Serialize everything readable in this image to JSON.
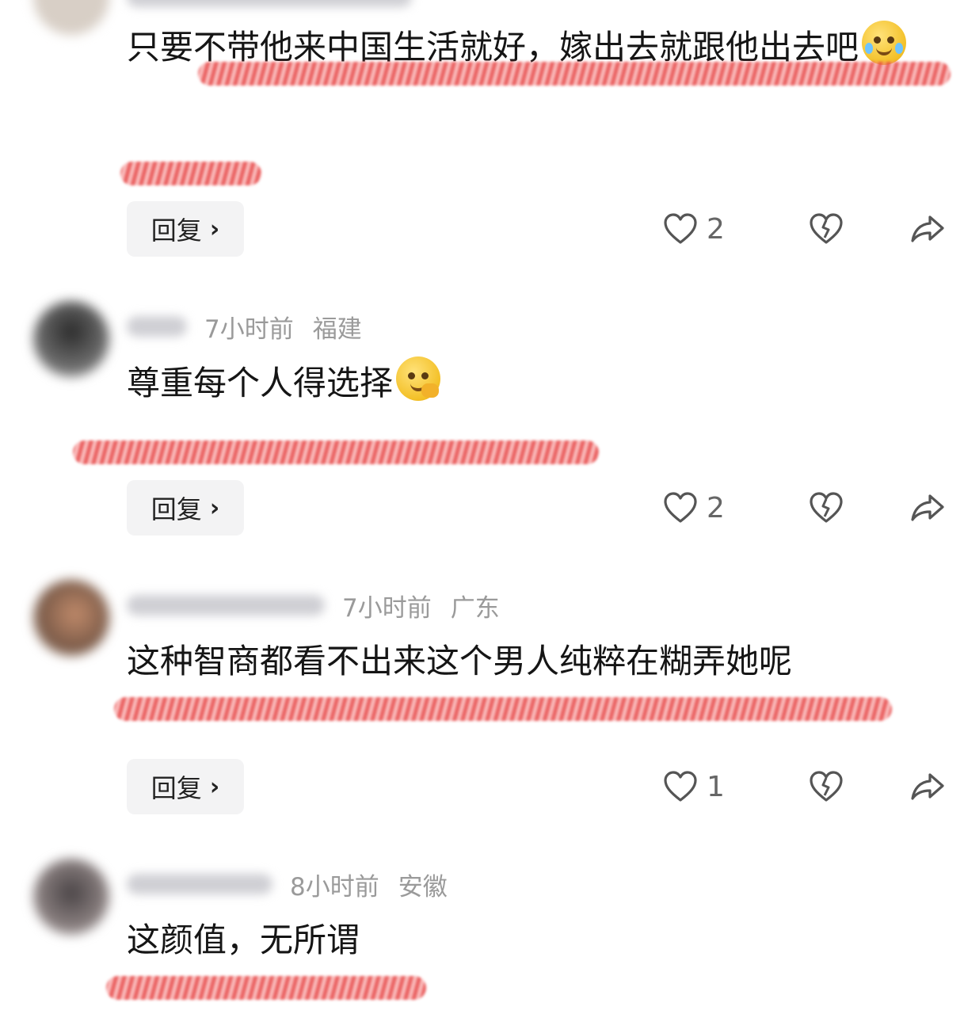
{
  "comments": [
    {
      "time": "",
      "location": "",
      "text": "只要不带他来中国生活就好，嫁出去就跟他出去吧",
      "emoji": "crying-face",
      "reply_label": "回复",
      "likes": "2"
    },
    {
      "time": "7小时前",
      "location": "福建",
      "text": "尊重每个人得选择",
      "emoji": "hand-over-mouth-face",
      "reply_label": "回复",
      "likes": "2"
    },
    {
      "time": "7小时前",
      "location": "广东",
      "text": "这种智商都看不出来这个男人纯粹在糊弄她呢",
      "emoji": "",
      "reply_label": "回复",
      "likes": "1"
    },
    {
      "time": "8小时前",
      "location": "安徽",
      "text": "这颜值，无所谓",
      "emoji": "",
      "reply_label": "",
      "likes": ""
    }
  ],
  "icons": {
    "like": "heart-icon",
    "dislike": "broken-heart-icon",
    "share": "share-arrow-icon",
    "reply_chevron": "chevron-right-icon"
  },
  "colors": {
    "scribble": "#e84a4a",
    "meta_text": "#9a9a9a",
    "reply_bg": "#f3f3f4"
  }
}
